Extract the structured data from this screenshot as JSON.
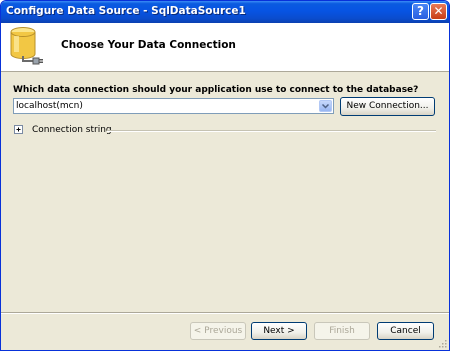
{
  "window": {
    "title": "Configure Data Source - SqlDataSource1",
    "help_glyph": "?",
    "close_glyph": "✕"
  },
  "header": {
    "title": "Choose Your Data Connection",
    "icon": "database-connection-icon"
  },
  "main": {
    "question": "Which data connection should your application use to connect to the database?",
    "connection_combo": {
      "value": "localhost(mcn)",
      "icon": "chevron-down-icon"
    },
    "new_connection_label": "New Connection...",
    "connection_string_label": "Connection string",
    "expander_icon": "plus-icon",
    "expander_state": "collapsed"
  },
  "footer": {
    "previous_label": "< Previous",
    "previous_enabled": false,
    "next_label": "Next >",
    "next_enabled": true,
    "finish_label": "Finish",
    "finish_enabled": false,
    "cancel_label": "Cancel",
    "cancel_enabled": true
  },
  "colors": {
    "titlebar": "#0754e3",
    "dialog_background": "#ece9d8",
    "header_background": "#ffffff",
    "button_border": "#003c74",
    "disabled_text": "#aca899"
  }
}
